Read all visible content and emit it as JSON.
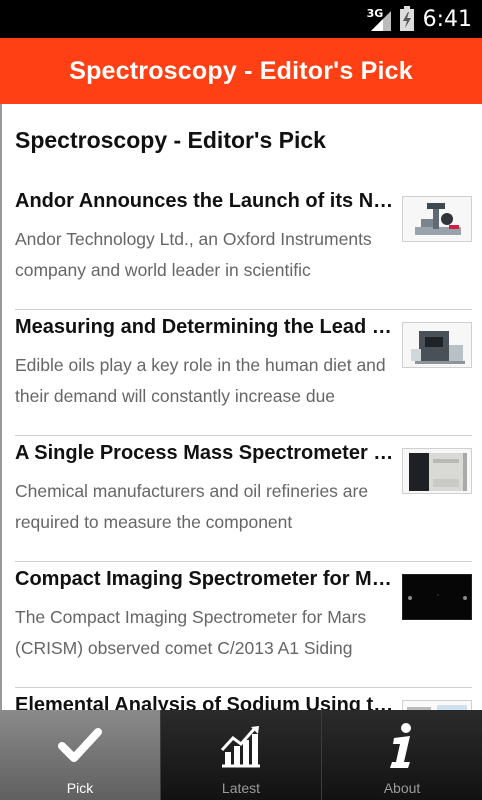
{
  "status_bar": {
    "network": "3G",
    "time": "6:41"
  },
  "app_bar": {
    "title": "Spectroscopy - Editor's Pick"
  },
  "section": {
    "title": "Spectroscopy - Editor's Pick"
  },
  "articles": [
    {
      "headline": "Andor Announces the Launch of its Ne…",
      "summary": "Andor Technology Ltd., an Oxford Instruments company and world leader in scientific",
      "thumbnail": "microscope-instrument"
    },
    {
      "headline": "Measuring and Determining the Lead (…",
      "summary": "Edible oils play a key role in the human diet and their demand will constantly increase due",
      "thumbnail": "spectrometer-instrument"
    },
    {
      "headline": "A Single Process Mass Spectrometer …",
      "summary": "Chemical manufacturers and oil refineries are required to measure the component",
      "thumbnail": "mass-spectrometer-cabinet"
    },
    {
      "headline": "Compact Imaging Spectrometer for M…",
      "summary": "The Compact Imaging Spectrometer for Mars (CRISM) observed comet C/2013 A1 Siding",
      "thumbnail": "dark-space-image"
    },
    {
      "headline": "Elemental Analysis of Sodium Using t…",
      "summary": "",
      "thumbnail": "chart-document"
    }
  ],
  "tabs": [
    {
      "label": "Pick",
      "icon": "check-icon",
      "active": true
    },
    {
      "label": "Latest",
      "icon": "chart-icon",
      "active": false
    },
    {
      "label": "About",
      "icon": "info-icon",
      "active": false
    }
  ],
  "colors": {
    "accent": "#ff4014",
    "text": "#111111",
    "summary_text": "#666666"
  }
}
